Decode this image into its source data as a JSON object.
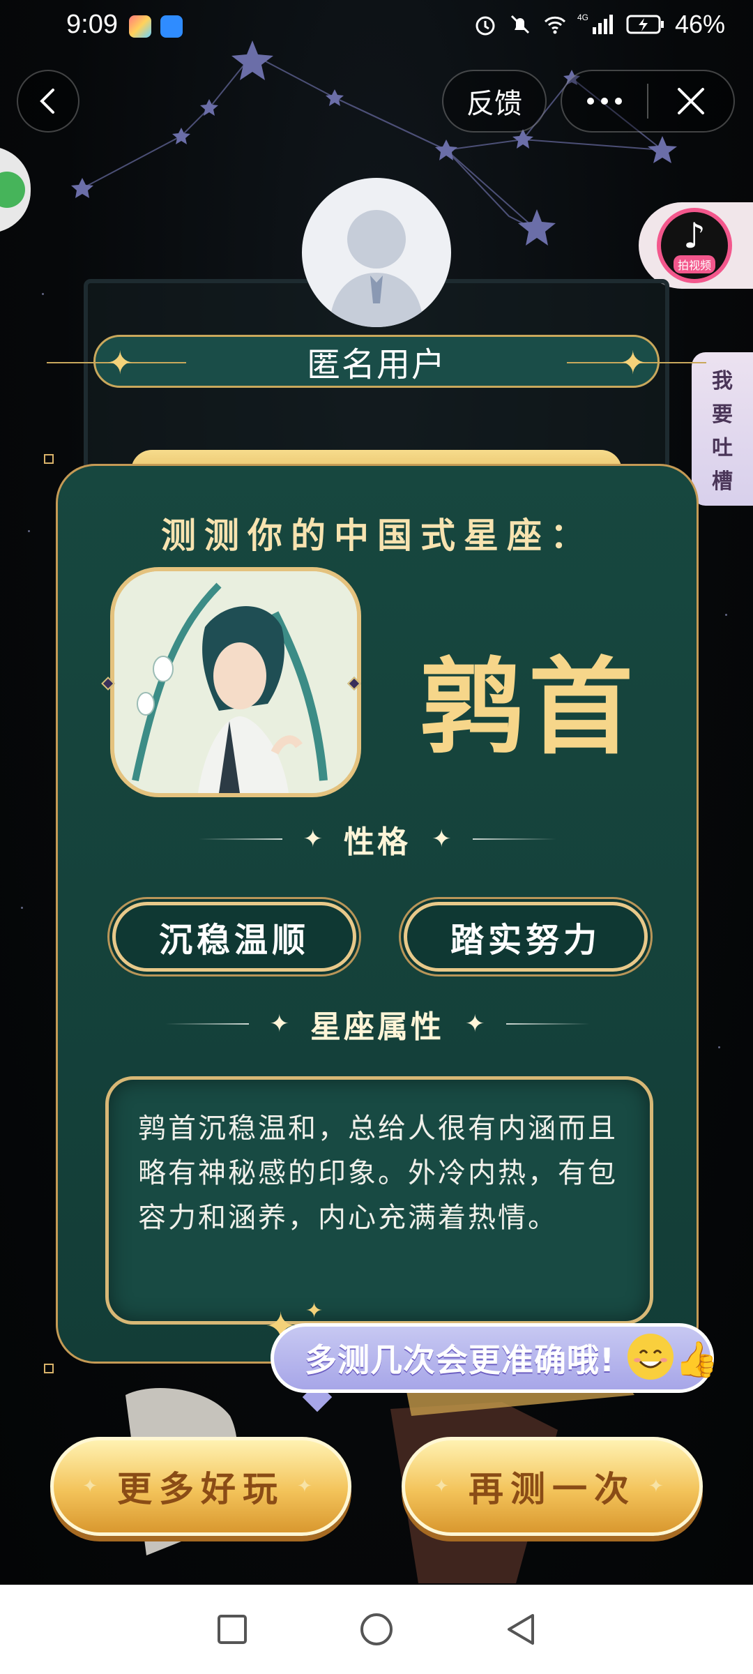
{
  "status_bar": {
    "time": "9:09",
    "battery": "46%",
    "network": "4G"
  },
  "nav": {
    "feedback_label": "反馈",
    "more_icon": "more-dots-icon",
    "close_icon": "close-icon",
    "back_icon": "chevron-left-icon"
  },
  "floaters": {
    "video_label": "拍视频",
    "complain_chars": [
      "我",
      "要",
      "吐",
      "槽"
    ]
  },
  "user": {
    "name": "匿名用户"
  },
  "card": {
    "title": "测测你的中国式星座：",
    "constellation": "鹑首",
    "personality_heading": "性格",
    "traits": [
      "沉稳温顺",
      "踏实努力"
    ],
    "attribute_heading": "星座属性",
    "description": "鹑首沉稳温和，总给人很有内涵而且略有神秘感的印象。外冷内热，有包容力和涵养，内心充满着热情。"
  },
  "tip": {
    "text": "多测几次会更准确哦!"
  },
  "buttons": {
    "more_fun": "更多好玩",
    "retest": "再测一次"
  },
  "colors": {
    "card_bg": "#17473f",
    "gold": "#c59a55",
    "title_gold": "#f6d68a",
    "tip_purple": "#a7a6e8",
    "button_text": "#8a4c16"
  }
}
